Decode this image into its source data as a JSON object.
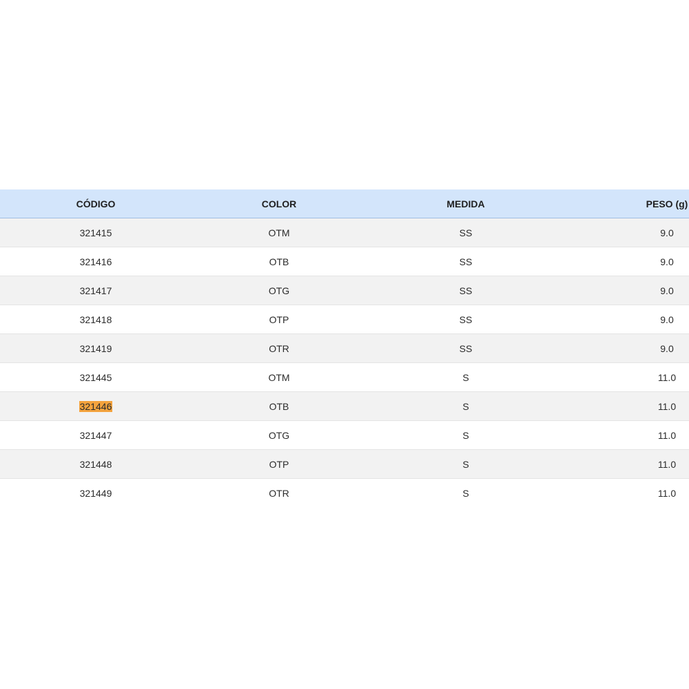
{
  "table": {
    "headers": {
      "codigo": "CÓDIGO",
      "color": "COLOR",
      "medida": "MEDIDA",
      "peso": "PESO (g)"
    },
    "rows": [
      {
        "codigo": "321415",
        "color": "OTM",
        "medida": "SS",
        "peso": "9.0"
      },
      {
        "codigo": "321416",
        "color": "OTB",
        "medida": "SS",
        "peso": "9.0"
      },
      {
        "codigo": "321417",
        "color": "OTG",
        "medida": "SS",
        "peso": "9.0"
      },
      {
        "codigo": "321418",
        "color": "OTP",
        "medida": "SS",
        "peso": "9.0"
      },
      {
        "codigo": "321419",
        "color": "OTR",
        "medida": "SS",
        "peso": "9.0"
      },
      {
        "codigo": "321445",
        "color": "OTM",
        "medida": "S",
        "peso": "11.0"
      },
      {
        "codigo": "321446",
        "color": "OTB",
        "medida": "S",
        "peso": "11.0"
      },
      {
        "codigo": "321447",
        "color": "OTG",
        "medida": "S",
        "peso": "11.0"
      },
      {
        "codigo": "321448",
        "color": "OTP",
        "medida": "S",
        "peso": "11.0"
      },
      {
        "codigo": "321449",
        "color": "OTR",
        "medida": "S",
        "peso": "11.0"
      }
    ],
    "highlighted_code": "321446"
  },
  "colors": {
    "header_background": "#d3e5fb",
    "odd_row_background": "#f2f2f2",
    "highlight": "#f4a33d"
  }
}
